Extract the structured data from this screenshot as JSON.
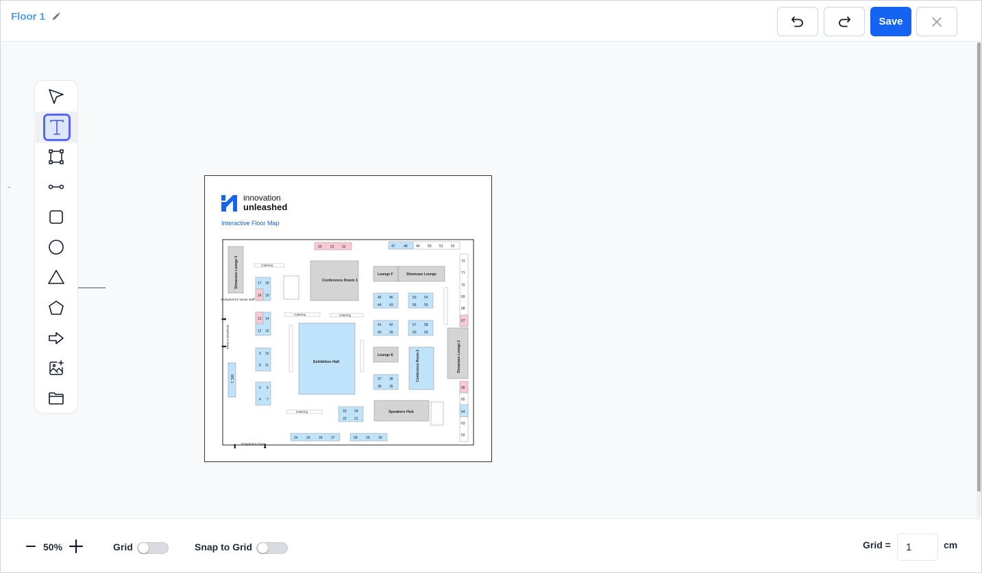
{
  "header": {
    "floor_name": "Floor 1",
    "save_label": "Save"
  },
  "toolbar": {
    "tools": [
      "select-icon",
      "text-icon",
      "polygon-node-icon",
      "line-icon",
      "rectangle-icon",
      "circle-icon",
      "triangle-icon",
      "pentagon-icon",
      "arrow-icon",
      "add-image-icon",
      "folder-icon"
    ],
    "active_tool": "text-icon"
  },
  "floor_plan": {
    "logo_line1": "innovation",
    "logo_line2": "unleashed",
    "subtitle": "Interactive Floor Map",
    "rooms": {
      "showcase_lounge_3": "Showcase Lounge 3",
      "conference_room_1": "Conference Room 1",
      "lounge_f": "Lounge F",
      "showcase_lounge": "Showcase Lounge",
      "exhibition_hall": "Exhibition Hall",
      "lounge_e": "Lounge E",
      "conference_room_2": "Conference Room 2",
      "showcase_lounge_2": "Showcase Lounge 2",
      "speakers_hub": "Speakers Hub",
      "wc": "WC 1"
    },
    "catering": "Catering",
    "entry_staff": "Entry/exit for venue staff",
    "entry_expo_top": "Entry/exit to Expo",
    "entry_expo_bottom": "Entry/exit to Expo",
    "booths_top_pink": [
      "20",
      "21",
      "22"
    ],
    "booths_top_right": [
      "47",
      "48",
      "49",
      "50",
      "51",
      "52"
    ],
    "booths_right_col": [
      "72",
      "71",
      "70",
      "69",
      "68",
      "67"
    ],
    "booths_right_col2": [
      "66",
      "65",
      "64",
      "63",
      "62"
    ],
    "booths_bottom_left": [
      "24",
      "25",
      "26",
      "27"
    ],
    "booths_bottom_mid": [
      "28",
      "29",
      "30"
    ]
  },
  "footer": {
    "zoom_level": "50%",
    "grid_label": "Grid",
    "snap_label": "Snap to Grid",
    "grid_size_label": "Grid =",
    "grid_size_value": "1",
    "grid_unit": "cm",
    "grid_on": false,
    "snap_on": false
  },
  "colors": {
    "accent": "#1463f3",
    "title": "#4f9fea",
    "active_tool_border": "#5865f2",
    "booth_blue": "#bfe3fa",
    "booth_pink": "#f6c9d3",
    "room_gray": "#d4d4d4"
  }
}
